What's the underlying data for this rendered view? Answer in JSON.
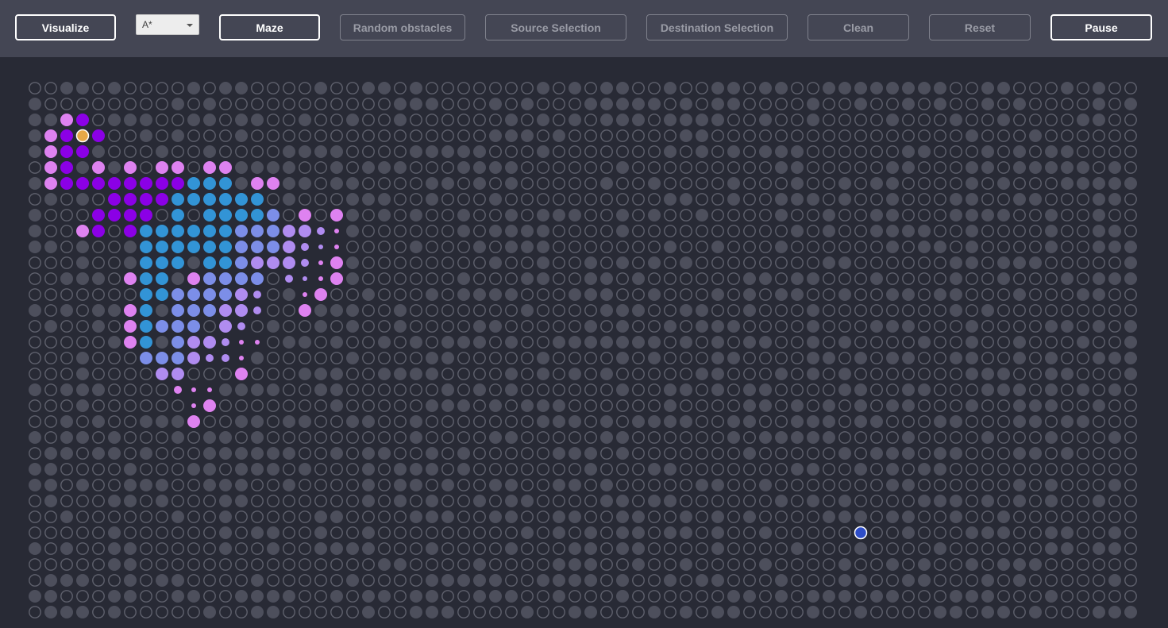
{
  "toolbar": {
    "visualize_label": "Visualize",
    "algorithm": {
      "selected": "A*"
    },
    "maze_label": "Maze",
    "random_obstacles_label": "Random obstacles",
    "source_selection_label": "Source Selection",
    "destination_selection_label": "Destination Selection",
    "clean_label": "Clean",
    "reset_label": "Reset",
    "pause_label": "Pause"
  },
  "colors": {
    "background": "#282a35",
    "toolbar": "#444654",
    "wall": "#4d4f5c",
    "empty_ring": "#5f616d",
    "visited_dark": "#8b00e6",
    "visited_pink": "#de82f0",
    "frontier_blue": "#3294d6",
    "frontier_periwinkle": "#7c8ee8",
    "frontier_lavender": "#b08cf0",
    "source": "#e5a847",
    "destination": "#2f4ec8"
  },
  "grid": {
    "rows": 34,
    "cols": 70,
    "source": {
      "row": 3,
      "col": 3
    },
    "destination": {
      "row": 28,
      "col": 52
    },
    "visited": [
      [
        2,
        2,
        "pink"
      ],
      [
        2,
        3,
        "dark"
      ],
      [
        3,
        1,
        "pink"
      ],
      [
        3,
        2,
        "dark"
      ],
      [
        3,
        4,
        "dark"
      ],
      [
        4,
        1,
        "pink"
      ],
      [
        4,
        2,
        "dark"
      ],
      [
        4,
        3,
        "dark"
      ],
      [
        5,
        1,
        "pink"
      ],
      [
        5,
        2,
        "dark"
      ],
      [
        5,
        4,
        "pink"
      ],
      [
        5,
        6,
        "pink"
      ],
      [
        5,
        8,
        "pink"
      ],
      [
        5,
        9,
        "pink"
      ],
      [
        5,
        11,
        "pink"
      ],
      [
        5,
        12,
        "pink"
      ],
      [
        6,
        1,
        "pink"
      ],
      [
        6,
        2,
        "dark"
      ],
      [
        6,
        3,
        "dark"
      ],
      [
        6,
        4,
        "dark"
      ],
      [
        6,
        5,
        "dark"
      ],
      [
        6,
        6,
        "dark"
      ],
      [
        6,
        7,
        "dark"
      ],
      [
        6,
        8,
        "dark"
      ],
      [
        6,
        9,
        "dark"
      ],
      [
        6,
        10,
        "blue"
      ],
      [
        6,
        11,
        "blue"
      ],
      [
        6,
        12,
        "blue"
      ],
      [
        6,
        14,
        "pink"
      ],
      [
        6,
        15,
        "pink"
      ],
      [
        7,
        5,
        "dark"
      ],
      [
        7,
        6,
        "dark"
      ],
      [
        7,
        7,
        "dark"
      ],
      [
        7,
        8,
        "dark"
      ],
      [
        7,
        9,
        "blue"
      ],
      [
        7,
        10,
        "blue"
      ],
      [
        7,
        11,
        "blue"
      ],
      [
        7,
        12,
        "blue"
      ],
      [
        7,
        13,
        "blue"
      ],
      [
        7,
        14,
        "blue"
      ],
      [
        8,
        4,
        "dark"
      ],
      [
        8,
        5,
        "dark"
      ],
      [
        8,
        6,
        "dark"
      ],
      [
        8,
        7,
        "dark"
      ],
      [
        8,
        9,
        "blue"
      ],
      [
        8,
        11,
        "blue"
      ],
      [
        8,
        12,
        "blue"
      ],
      [
        8,
        13,
        "blue"
      ],
      [
        8,
        14,
        "blue"
      ],
      [
        8,
        15,
        "peri"
      ],
      [
        8,
        17,
        "pink"
      ],
      [
        8,
        19,
        "pink"
      ],
      [
        9,
        3,
        "pink"
      ],
      [
        9,
        4,
        "dark"
      ],
      [
        9,
        6,
        "dark"
      ],
      [
        9,
        7,
        "blue"
      ],
      [
        9,
        8,
        "blue"
      ],
      [
        9,
        9,
        "blue"
      ],
      [
        9,
        10,
        "blue"
      ],
      [
        9,
        11,
        "blue"
      ],
      [
        9,
        12,
        "blue"
      ],
      [
        9,
        13,
        "peri"
      ],
      [
        9,
        14,
        "peri"
      ],
      [
        9,
        15,
        "peri"
      ],
      [
        9,
        16,
        "lav"
      ],
      [
        9,
        17,
        "lav"
      ],
      [
        9,
        18,
        "lav",
        "s"
      ],
      [
        9,
        19,
        "pink",
        "xs"
      ],
      [
        10,
        7,
        "blue"
      ],
      [
        10,
        8,
        "blue"
      ],
      [
        10,
        9,
        "blue"
      ],
      [
        10,
        10,
        "blue"
      ],
      [
        10,
        11,
        "blue"
      ],
      [
        10,
        12,
        "blue"
      ],
      [
        10,
        13,
        "peri"
      ],
      [
        10,
        14,
        "peri"
      ],
      [
        10,
        15,
        "peri"
      ],
      [
        10,
        16,
        "lav"
      ],
      [
        10,
        17,
        "lav",
        "s"
      ],
      [
        10,
        18,
        "lav",
        "xs"
      ],
      [
        10,
        19,
        "pink",
        "xs"
      ],
      [
        11,
        7,
        "blue"
      ],
      [
        11,
        8,
        "blue"
      ],
      [
        11,
        9,
        "blue"
      ],
      [
        11,
        11,
        "blue"
      ],
      [
        11,
        12,
        "blue"
      ],
      [
        11,
        13,
        "peri"
      ],
      [
        11,
        14,
        "lav"
      ],
      [
        11,
        15,
        "lav"
      ],
      [
        11,
        16,
        "lav"
      ],
      [
        11,
        17,
        "lav",
        "s"
      ],
      [
        11,
        18,
        "pink",
        "xs"
      ],
      [
        11,
        19,
        "pink"
      ],
      [
        12,
        6,
        "pink"
      ],
      [
        12,
        7,
        "blue"
      ],
      [
        12,
        8,
        "blue"
      ],
      [
        12,
        10,
        "pink"
      ],
      [
        12,
        11,
        "peri"
      ],
      [
        12,
        12,
        "peri"
      ],
      [
        12,
        13,
        "peri"
      ],
      [
        12,
        14,
        "peri"
      ],
      [
        12,
        16,
        "lav",
        "s"
      ],
      [
        12,
        17,
        "lav",
        "xs"
      ],
      [
        12,
        18,
        "pink",
        "xs"
      ],
      [
        12,
        19,
        "pink"
      ],
      [
        13,
        7,
        "blue"
      ],
      [
        13,
        8,
        "blue"
      ],
      [
        13,
        9,
        "peri"
      ],
      [
        13,
        10,
        "peri"
      ],
      [
        13,
        11,
        "peri"
      ],
      [
        13,
        12,
        "peri"
      ],
      [
        13,
        13,
        "lav"
      ],
      [
        13,
        14,
        "lav",
        "s"
      ],
      [
        13,
        17,
        "pink",
        "xs"
      ],
      [
        13,
        18,
        "pink"
      ],
      [
        14,
        6,
        "pink"
      ],
      [
        14,
        7,
        "blue"
      ],
      [
        14,
        9,
        "peri"
      ],
      [
        14,
        10,
        "peri"
      ],
      [
        14,
        11,
        "peri"
      ],
      [
        14,
        12,
        "lav"
      ],
      [
        14,
        13,
        "lav"
      ],
      [
        14,
        14,
        "lav",
        "s"
      ],
      [
        14,
        17,
        "pink"
      ],
      [
        15,
        6,
        "pink"
      ],
      [
        15,
        7,
        "blue"
      ],
      [
        15,
        8,
        "peri"
      ],
      [
        15,
        9,
        "peri"
      ],
      [
        15,
        10,
        "peri"
      ],
      [
        15,
        12,
        "lav"
      ],
      [
        15,
        13,
        "lav",
        "s"
      ],
      [
        16,
        6,
        "pink"
      ],
      [
        16,
        7,
        "blue"
      ],
      [
        16,
        9,
        "peri"
      ],
      [
        16,
        10,
        "lav"
      ],
      [
        16,
        11,
        "lav"
      ],
      [
        16,
        12,
        "lav",
        "s"
      ],
      [
        16,
        13,
        "pink",
        "xs"
      ],
      [
        16,
        14,
        "pink",
        "xs"
      ],
      [
        17,
        7,
        "peri"
      ],
      [
        17,
        8,
        "peri"
      ],
      [
        17,
        9,
        "peri"
      ],
      [
        17,
        10,
        "lav"
      ],
      [
        17,
        11,
        "lav",
        "s"
      ],
      [
        17,
        12,
        "lav",
        "s"
      ],
      [
        17,
        13,
        "pink",
        "xs"
      ],
      [
        18,
        8,
        "lav"
      ],
      [
        18,
        9,
        "lav"
      ],
      [
        18,
        13,
        "pink"
      ],
      [
        19,
        9,
        "pink",
        "s"
      ],
      [
        19,
        10,
        "pink",
        "xs"
      ],
      [
        19,
        11,
        "pink",
        "xs"
      ],
      [
        20,
        10,
        "pink",
        "xs"
      ],
      [
        20,
        11,
        "pink"
      ],
      [
        21,
        10,
        "pink"
      ]
    ]
  }
}
